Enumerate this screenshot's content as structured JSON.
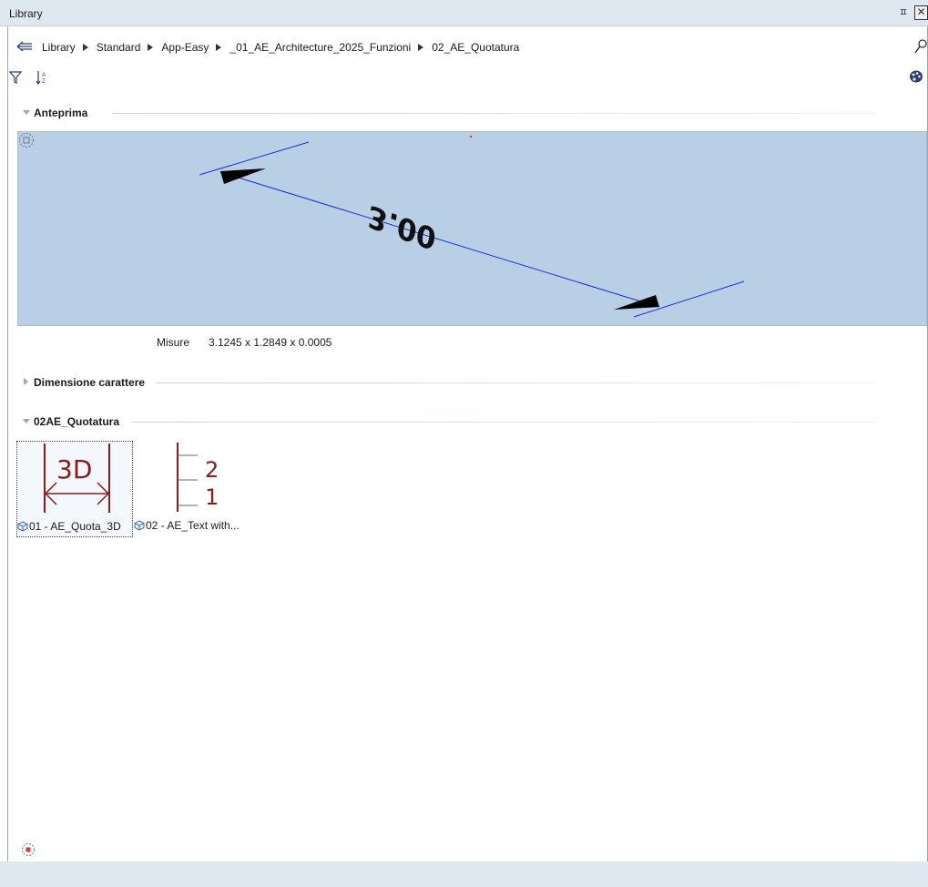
{
  "window": {
    "title": "Library",
    "pin_glyph": "ㅍ",
    "close_glyph": "✕"
  },
  "breadcrumb": {
    "items": [
      "Library",
      "Standard",
      "App-Easy",
      "_01_AE_Architecture_2025_Funzioni",
      "02_AE_Quotatura"
    ]
  },
  "toolbar": {
    "filter_icon": "filter-icon",
    "sort_icon": "sort-az-icon",
    "palette_icon": "palette-icon"
  },
  "sections": {
    "preview": {
      "title": "Anteprima",
      "expanded": true
    },
    "char_size": {
      "title": "Dimensione carattere",
      "expanded": false
    },
    "folder": {
      "title": "02AE_Quotatura",
      "expanded": true
    }
  },
  "preview": {
    "dimension_text": "3.00",
    "measure_label": "Misure",
    "measure_value": "3.1245 x 1.2849 x 0.0005"
  },
  "items": [
    {
      "label": "01 - AE_Quota_3D",
      "thumb_text": "3D",
      "selected": true
    },
    {
      "label": "02 - AE_Text with...",
      "thumb_top": "2",
      "thumb_bottom": "1",
      "selected": false
    }
  ],
  "colors": {
    "preview_bg": "#b9cfe6",
    "dimension_line": "#1f2fd6",
    "thumb_red": "#8b1a1a",
    "chrome": "#dfe7f1"
  }
}
